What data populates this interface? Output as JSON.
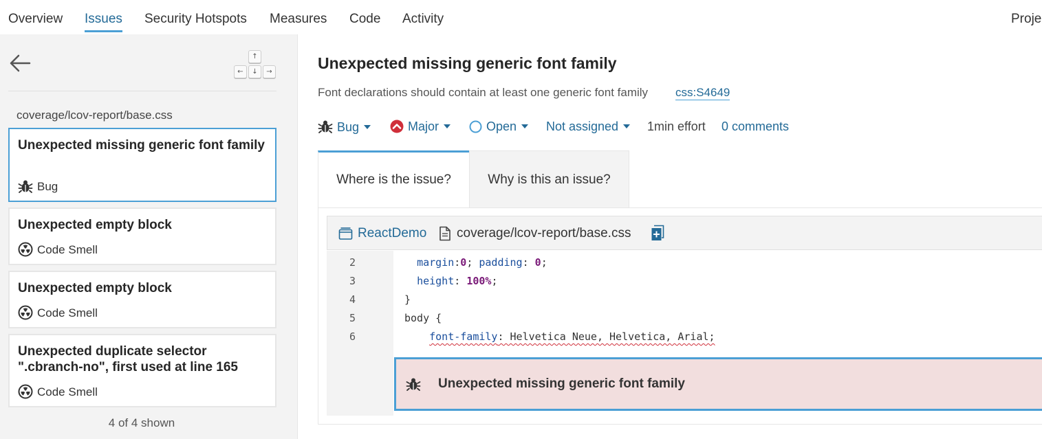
{
  "nav": {
    "tabs": [
      "Overview",
      "Issues",
      "Security Hotspots",
      "Measures",
      "Code",
      "Activity"
    ],
    "project_settings": "Proje"
  },
  "sidebar": {
    "keyboard_hints": [
      "↑",
      "←",
      "↓",
      "→"
    ],
    "component": "coverage/lcov-report/base.css",
    "issues": [
      {
        "title": "Unexpected missing generic font family",
        "type": "Bug",
        "type_icon": "bug-icon",
        "selected": true
      },
      {
        "title": "Unexpected empty block",
        "type": "Code Smell",
        "type_icon": "code-smell-icon"
      },
      {
        "title": "Unexpected empty block",
        "type": "Code Smell",
        "type_icon": "code-smell-icon"
      },
      {
        "title": "Unexpected duplicate selector \".cbranch-no\", first used at line 165",
        "type": "Code Smell",
        "type_icon": "code-smell-icon"
      }
    ],
    "shown_count": "4 of 4 shown"
  },
  "issue": {
    "title": "Unexpected missing generic font family",
    "rule_description": "Font declarations should contain at least one generic font family",
    "rule_key": "css:S4649",
    "type": "Bug",
    "severity": "Major",
    "status": "Open",
    "assignee": "Not assigned",
    "effort": "1min effort",
    "comments": "0 comments"
  },
  "tabs": {
    "where": "Where is the issue?",
    "why": "Why is this an issue?"
  },
  "viewer": {
    "project": "ReactDemo",
    "file": "coverage/lcov-report/base.css",
    "lines": [
      {
        "n": "2",
        "tokens": [
          {
            "t": "  ",
            "c": ""
          },
          {
            "t": "margin",
            "c": "prop"
          },
          {
            "t": ":",
            "c": ""
          },
          {
            "t": "0",
            "c": "num"
          },
          {
            "t": "; ",
            "c": ""
          },
          {
            "t": "padding",
            "c": "prop"
          },
          {
            "t": ": ",
            "c": ""
          },
          {
            "t": "0",
            "c": "num"
          },
          {
            "t": ";",
            "c": ""
          }
        ]
      },
      {
        "n": "3",
        "tokens": [
          {
            "t": "  ",
            "c": ""
          },
          {
            "t": "height",
            "c": "prop"
          },
          {
            "t": ": ",
            "c": ""
          },
          {
            "t": "100%",
            "c": "num"
          },
          {
            "t": ";",
            "c": ""
          }
        ]
      },
      {
        "n": "4",
        "tokens": [
          {
            "t": "}",
            "c": ""
          }
        ]
      },
      {
        "n": "5",
        "tokens": [
          {
            "t": "body {",
            "c": ""
          }
        ]
      },
      {
        "n": "6",
        "tokens": [
          {
            "t": "    ",
            "c": ""
          },
          {
            "t": "font-family",
            "c": "prop squiggle"
          },
          {
            "t": ": Helvetica Neue, Helvetica, Arial;",
            "c": "squiggle"
          }
        ]
      }
    ],
    "secondary_message": "Unexpected missing generic font family"
  },
  "colors": {
    "link": "#236a97",
    "accent": "#4b9fd5",
    "issue_bg": "#f2dede",
    "major_red": "#d02f3a"
  }
}
